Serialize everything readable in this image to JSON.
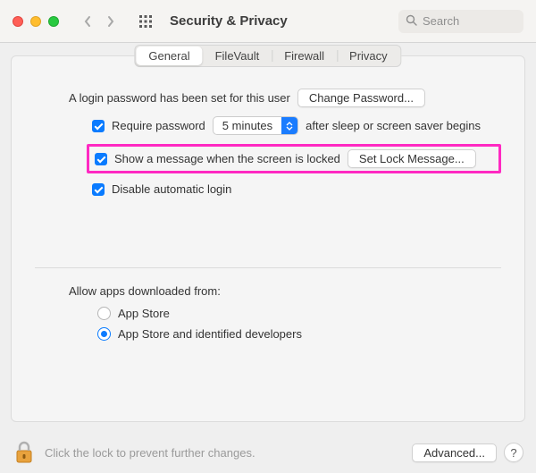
{
  "window": {
    "title": "Security & Privacy",
    "search_placeholder": "Search"
  },
  "tabs": {
    "general": "General",
    "filevault": "FileVault",
    "firewall": "Firewall",
    "privacy": "Privacy",
    "active": "general"
  },
  "general": {
    "password_set_text": "A login password has been set for this user",
    "change_password_btn": "Change Password...",
    "require_password": {
      "checked": true,
      "label_before": "Require password",
      "delay_value": "5 minutes",
      "label_after": "after sleep or screen saver begins"
    },
    "lock_message": {
      "checked": true,
      "label": "Show a message when the screen is locked",
      "button": "Set Lock Message..."
    },
    "disable_auto_login": {
      "checked": true,
      "label": "Disable automatic login"
    },
    "allow_apps_label": "Allow apps downloaded from:",
    "allow_apps_options": {
      "app_store": "App Store",
      "app_store_dev": "App Store and identified developers",
      "selected": "app_store_dev"
    }
  },
  "footer": {
    "lock_text": "Click the lock to prevent further changes.",
    "advanced_btn": "Advanced...",
    "help_label": "?"
  },
  "icons": {
    "back": "chevron-left",
    "forward": "chevron-right",
    "apps_grid": "grid-icon",
    "search": "search-icon",
    "dropdown": "updown-chevron",
    "lock": "lock-icon"
  }
}
